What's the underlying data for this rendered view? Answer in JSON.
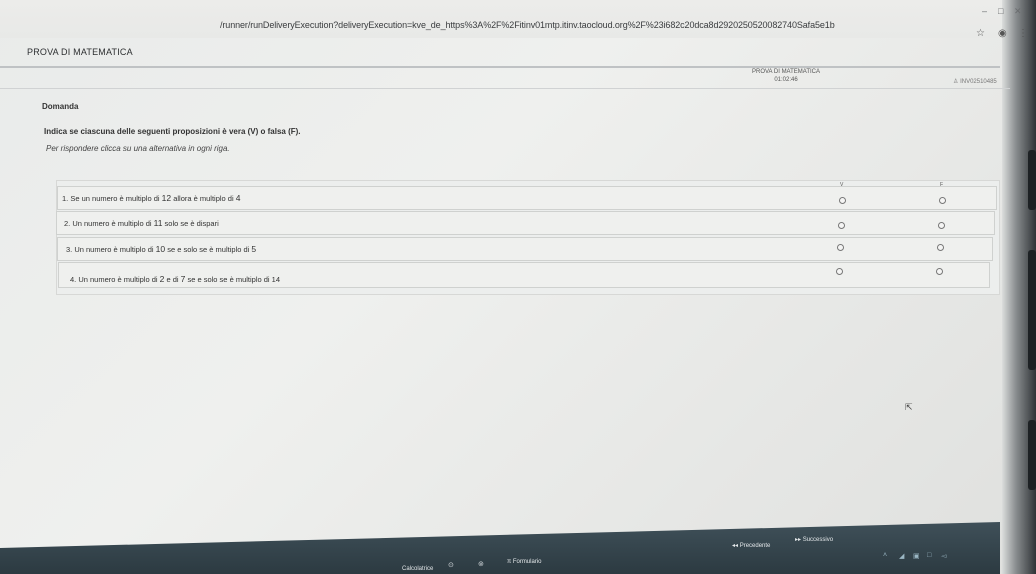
{
  "browser": {
    "url": "/runner/runDeliveryExecution?deliveryExecution=kve_de_https%3A%2F%2Fitinv01mtp.itinv.taocloud.org%2F%23i682c20dca8d2920250520082740Safa5e1b"
  },
  "header": {
    "title": "PROVA DI MATEMATICA",
    "test_name": "PROVA DI MATEMATICA",
    "timer": "01:02:46",
    "user_id": "INV02510485"
  },
  "question": {
    "section_label": "Domanda",
    "prompt": "Indica se ciascuna delle seguenti proposizioni è vera (V) o falsa (F).",
    "instruction": "Per rispondere clicca su una alternativa in ogni riga.",
    "col_true": "V",
    "col_false": "F",
    "rows": [
      {
        "pre": "1. Se un numero è multiplo di ",
        "num1": "12",
        "mid": " allora è multiplo di ",
        "num2": "4",
        "post": ""
      },
      {
        "pre": "2. Un numero è multiplo di ",
        "num1": "11",
        "mid": " solo se è dispari",
        "num2": "",
        "post": ""
      },
      {
        "pre": "3. Un numero è multiplo di ",
        "num1": "10",
        "mid": " se e solo se è multiplo di ",
        "num2": "5",
        "post": ""
      },
      {
        "pre": "4. Un numero è multiplo di ",
        "num1": "2",
        "mid": " e di ",
        "num2": "7",
        "post": " se e solo se è multiplo di 14"
      }
    ]
  },
  "footer": {
    "formulario": "Formulario",
    "prev": "Precedente",
    "next": "Successivo",
    "calc": "Calcolatrice"
  },
  "colors": {
    "footer_bg": "#34454d",
    "page_bg": "#eceeed"
  }
}
